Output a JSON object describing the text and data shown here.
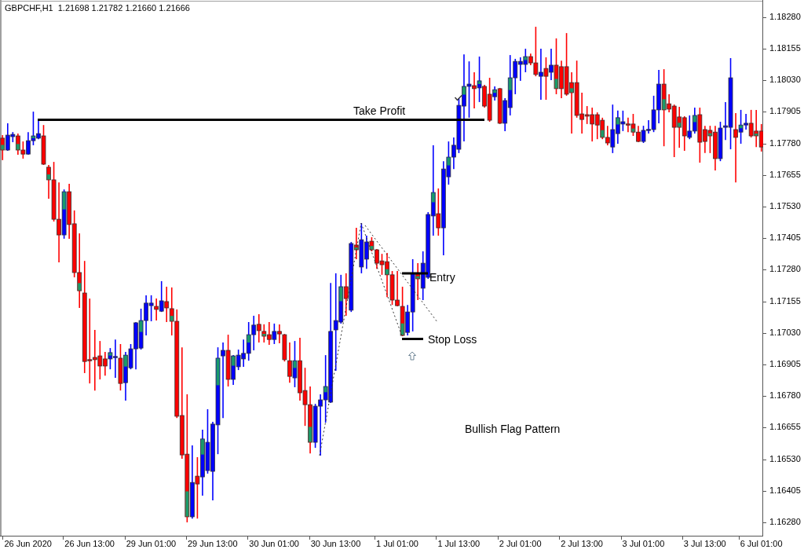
{
  "header": {
    "symbol": "GBPCHF,H1",
    "quote": "1.21698 1.21782 1.21660 1.21666"
  },
  "annotations": [
    {
      "kind": "level",
      "label": "Take Profit"
    },
    {
      "kind": "level",
      "label": "Entry"
    },
    {
      "kind": "level",
      "label": "Stop Loss"
    },
    {
      "kind": "caption",
      "label": "Bullish Flag Pattern"
    }
  ],
  "chart_data": {
    "type": "candlestick",
    "ylim": [
      1.16224,
      1.18348
    ],
    "yticks": [
      {
        "value": 1.1828,
        "label": "1.18280"
      },
      {
        "value": 1.18155,
        "label": "1.18155"
      },
      {
        "value": 1.1803,
        "label": "1.18030"
      },
      {
        "value": 1.17905,
        "label": "1.17905"
      },
      {
        "value": 1.1778,
        "label": "1.17780"
      },
      {
        "value": 1.17655,
        "label": "1.17655"
      },
      {
        "value": 1.1753,
        "label": "1.17530"
      },
      {
        "value": 1.17405,
        "label": "1.17405"
      },
      {
        "value": 1.1728,
        "label": "1.17280"
      },
      {
        "value": 1.17155,
        "label": "1.17155"
      },
      {
        "value": 1.1703,
        "label": "1.17030"
      },
      {
        "value": 1.16905,
        "label": "1.16905"
      },
      {
        "value": 1.1678,
        "label": "1.16780"
      },
      {
        "value": 1.16655,
        "label": "1.16655"
      },
      {
        "value": 1.1653,
        "label": "1.16530"
      },
      {
        "value": 1.16405,
        "label": "1.16405"
      },
      {
        "value": 1.1628,
        "label": "1.16280"
      }
    ],
    "categories": [
      null,
      null,
      null,
      null,
      null,
      "26 Jun 2020",
      null,
      null,
      null,
      null,
      null,
      null,
      null,
      null,
      null,
      null,
      null,
      "26 Jun 13:00",
      null,
      null,
      null,
      null,
      null,
      null,
      null,
      null,
      null,
      null,
      null,
      "29 Jun 01:00",
      null,
      null,
      null,
      null,
      null,
      null,
      null,
      null,
      null,
      null,
      null,
      "29 Jun 13:00",
      null,
      null,
      null,
      null,
      null,
      null,
      null,
      null,
      null,
      null,
      null,
      "30 Jun 01:00",
      null,
      null,
      null,
      null,
      null,
      null,
      null,
      null,
      null,
      null,
      null,
      "30 Jun 13:00",
      null,
      null,
      null,
      null,
      null,
      null,
      null,
      null,
      null,
      null,
      null,
      "1 Jul 01:00",
      null,
      null,
      null,
      null,
      null,
      null,
      null,
      null,
      null,
      null,
      null,
      "1 Jul 13:00",
      null,
      null,
      null,
      null,
      null,
      null,
      null,
      null,
      null,
      null,
      null,
      "2 Jul 01:00",
      null,
      null,
      null,
      null,
      null,
      null,
      null,
      null,
      null,
      null,
      null,
      "2 Jul 13:00",
      null,
      null,
      null,
      null,
      null,
      null,
      null,
      null,
      null,
      null,
      null,
      "3 Jul 01:00",
      null,
      null,
      null,
      null,
      null,
      null,
      null,
      null,
      null,
      null,
      null,
      "3 Jul 13:00",
      null,
      null,
      null,
      null,
      null,
      null,
      null,
      null,
      null,
      null,
      "6 Jul 01:00"
    ],
    "ohlc": [
      [
        1.17801,
        1.17813,
        1.17714,
        1.17754
      ],
      [
        1.17754,
        1.1786,
        1.17751,
        1.17813
      ],
      [
        1.17807,
        1.17825,
        1.17785,
        1.17816
      ],
      [
        1.1781,
        1.17819,
        1.17735,
        1.17754
      ],
      [
        1.17754,
        1.17788,
        1.1772,
        1.17738
      ],
      [
        1.17738,
        1.17825,
        1.17735,
        1.17791
      ],
      [
        1.17791,
        1.17906,
        1.17773,
        1.1781
      ],
      [
        1.17801,
        1.17872,
        1.17797,
        1.17819
      ],
      [
        1.1781,
        1.17853,
        1.17695,
        1.17698
      ],
      [
        1.17686,
        1.17695,
        1.17561,
        1.17636
      ],
      [
        1.17636,
        1.17707,
        1.17471,
        1.1748
      ],
      [
        1.1748,
        1.17626,
        1.17309,
        1.17418
      ],
      [
        1.17418,
        1.17598,
        1.17403,
        1.17589
      ],
      [
        1.17589,
        1.1762,
        1.17403,
        1.17459
      ],
      [
        1.17462,
        1.17515,
        1.1725,
        1.17269
      ],
      [
        1.17269,
        1.17424,
        1.17129,
        1.17197
      ],
      [
        1.17188,
        1.17315,
        1.16871,
        1.16917
      ],
      [
        1.16924,
        1.17166,
        1.1683,
        1.1692
      ],
      [
        1.16933,
        1.17042,
        1.16802,
        1.16924
      ],
      [
        1.16939,
        1.16998,
        1.16846,
        1.16899
      ],
      [
        1.16927,
        1.16955,
        1.16861,
        1.16899
      ],
      [
        1.16927,
        1.1697,
        1.16886,
        1.16952
      ],
      [
        1.16933,
        1.17004,
        1.16852,
        1.16936
      ],
      [
        1.1693,
        1.16986,
        1.16802,
        1.1683
      ],
      [
        1.16833,
        1.16955,
        1.16762,
        1.16942
      ],
      [
        1.16892,
        1.16986,
        1.16886,
        1.16967
      ],
      [
        1.16967,
        1.17073,
        1.16886,
        1.1707
      ],
      [
        1.1697,
        1.17126,
        1.16964,
        1.17079
      ],
      [
        1.17079,
        1.17179,
        1.1702,
        1.17148
      ],
      [
        1.17138,
        1.17179,
        1.17076,
        1.17148
      ],
      [
        1.17135,
        1.17166,
        1.17079,
        1.17123
      ],
      [
        1.17116,
        1.17235,
        1.17113,
        1.17157
      ],
      [
        1.17154,
        1.17213,
        1.17073,
        1.17129
      ],
      [
        1.17126,
        1.1721,
        1.1702,
        1.17076
      ],
      [
        1.17076,
        1.17123,
        1.16693,
        1.167
      ],
      [
        1.16703,
        1.16973,
        1.16532,
        1.16547
      ],
      [
        1.1655,
        1.16787,
        1.1628,
        1.16302
      ],
      [
        1.16302,
        1.16585,
        1.16295,
        1.16438
      ],
      [
        1.16463,
        1.16538,
        1.16295,
        1.16432
      ],
      [
        1.1646,
        1.16647,
        1.16386,
        1.1661
      ],
      [
        1.16485,
        1.16728,
        1.16473,
        1.16597
      ],
      [
        1.16482,
        1.16678,
        1.16367,
        1.16669
      ],
      [
        1.16666,
        1.16973,
        1.1655,
        1.1693
      ],
      [
        1.16939,
        1.16992,
        1.16693,
        1.16961
      ],
      [
        1.16961,
        1.17023,
        1.16818,
        1.16846
      ],
      [
        1.16846,
        1.16942,
        1.16824,
        1.16939
      ],
      [
        1.16896,
        1.16964,
        1.16883,
        1.16942
      ],
      [
        1.16927,
        1.17004,
        1.16896,
        1.16949
      ],
      [
        1.16949,
        1.17073,
        1.1692,
        1.17023
      ],
      [
        1.17023,
        1.17098,
        1.16961,
        1.17061
      ],
      [
        1.17064,
        1.17104,
        1.16992,
        1.17039
      ],
      [
        1.17036,
        1.17064,
        1.16992,
        1.17017
      ],
      [
        1.17023,
        1.17073,
        1.16983,
        1.17004
      ],
      [
        1.17004,
        1.17067,
        1.16986,
        1.17036
      ],
      [
        1.17036,
        1.17064,
        1.16989,
        1.17026
      ],
      [
        1.17023,
        1.17026,
        1.16917,
        1.16924
      ],
      [
        1.1692,
        1.16992,
        1.16833,
        1.16858
      ],
      [
        1.16852,
        1.16998,
        1.16815,
        1.1692
      ],
      [
        1.1692,
        1.17011,
        1.16762,
        1.16793
      ],
      [
        1.16802,
        1.16892,
        1.16662,
        1.16746
      ],
      [
        1.16746,
        1.16818,
        1.16553,
        1.16597
      ],
      [
        1.16597,
        1.16749,
        1.16575,
        1.1674
      ],
      [
        1.1674,
        1.16787,
        1.16544,
        1.16765
      ],
      [
        1.16765,
        1.16942,
        1.16675,
        1.16818
      ],
      [
        1.16756,
        1.17228,
        1.16753,
        1.17036
      ],
      [
        1.17042,
        1.17266,
        1.1688,
        1.17079
      ],
      [
        1.17073,
        1.1726,
        1.17067,
        1.17213
      ],
      [
        1.17213,
        1.17266,
        1.17098,
        1.17166
      ],
      [
        1.1712,
        1.1739,
        1.17113,
        1.17384
      ],
      [
        1.17378,
        1.17446,
        1.17322,
        1.17359
      ],
      [
        1.17291,
        1.17465,
        1.17266,
        1.17399
      ],
      [
        1.17322,
        1.17415,
        1.17284,
        1.1739
      ],
      [
        1.17393,
        1.17409,
        1.17353,
        1.17359
      ],
      [
        1.17359,
        1.17362,
        1.17284,
        1.17306
      ],
      [
        1.17315,
        1.17343,
        1.1726,
        1.173
      ],
      [
        1.17312,
        1.17347,
        1.17172,
        1.1726
      ],
      [
        1.1726,
        1.17275,
        1.17141,
        1.1716
      ],
      [
        1.1716,
        1.17275,
        1.17135,
        1.17138
      ],
      [
        1.17135,
        1.17213,
        1.17017,
        1.1702
      ],
      [
        1.17032,
        1.17141,
        1.1702,
        1.17113
      ],
      [
        1.17113,
        1.17322,
        1.17036,
        1.17266
      ],
      [
        1.17266,
        1.17306,
        1.1716,
        1.17244
      ],
      [
        1.17207,
        1.17353,
        1.1716,
        1.17306
      ],
      [
        1.1725,
        1.17508,
        1.17244,
        1.17499
      ],
      [
        1.17493,
        1.17773,
        1.17415,
        1.17586
      ],
      [
        1.17502,
        1.17602,
        1.17415,
        1.17446
      ],
      [
        1.17446,
        1.1771,
        1.17337,
        1.17679
      ],
      [
        1.17648,
        1.17788,
        1.17617,
        1.17726
      ],
      [
        1.17726,
        1.17804,
        1.17679,
        1.17773
      ],
      [
        1.17757,
        1.17959,
        1.17742,
        1.17931
      ],
      [
        1.17928,
        1.18133,
        1.17788,
        1.18006
      ],
      [
        1.18006,
        1.18105,
        1.17882,
        1.18015
      ],
      [
        1.18009,
        1.18062,
        1.17919,
        1.17997
      ],
      [
        1.18,
        1.18124,
        1.17944,
        1.18028
      ],
      [
        1.18006,
        1.18012,
        1.17922,
        1.17928
      ],
      [
        1.17975,
        1.1804,
        1.17866,
        1.17872
      ],
      [
        1.17965,
        1.18006,
        1.1795,
        1.17993
      ],
      [
        1.17997,
        1.18,
        1.17857,
        1.1786
      ],
      [
        1.1786,
        1.17959,
        1.17829,
        1.1795
      ],
      [
        1.17922,
        1.1813,
        1.17891,
        1.1804
      ],
      [
        1.1804,
        1.18115,
        1.17975,
        1.18105
      ],
      [
        1.18093,
        1.18121,
        1.18028,
        1.18105
      ],
      [
        1.18093,
        1.18155,
        1.18062,
        1.18124
      ],
      [
        1.18124,
        1.18136,
        1.1809,
        1.18099
      ],
      [
        1.18099,
        1.18242,
        1.18046,
        1.18053
      ],
      [
        1.18046,
        1.18155,
        1.17953,
        1.18062
      ],
      [
        1.18077,
        1.18121,
        1.17953,
        1.18046
      ],
      [
        1.18062,
        1.18155,
        1.18031,
        1.1809
      ],
      [
        1.1809,
        1.18196,
        1.17975,
        1.17997
      ],
      [
        1.18084,
        1.18108,
        1.17959,
        1.17997
      ],
      [
        1.18084,
        1.18217,
        1.17969,
        1.17975
      ],
      [
        1.18021,
        1.18062,
        1.17819,
        1.17981
      ],
      [
        1.18021,
        1.18108,
        1.17882,
        1.17891
      ],
      [
        1.17897,
        1.17981,
        1.17819,
        1.17875
      ],
      [
        1.17894,
        1.17928,
        1.17857,
        1.17888
      ],
      [
        1.17894,
        1.17922,
        1.17788,
        1.17857
      ],
      [
        1.17894,
        1.17903,
        1.17797,
        1.17853
      ],
      [
        1.17872,
        1.17882,
        1.17797,
        1.17804
      ],
      [
        1.17804,
        1.1785,
        1.17773,
        1.17782
      ],
      [
        1.17766,
        1.17934,
        1.17742,
        1.17835
      ],
      [
        1.17819,
        1.1791,
        1.17779,
        1.17882
      ],
      [
        1.17857,
        1.1791,
        1.17829,
        1.17866
      ],
      [
        1.17857,
        1.17882,
        1.17825,
        1.17853
      ],
      [
        1.17857,
        1.17897,
        1.1781,
        1.17825
      ],
      [
        1.17825,
        1.1785,
        1.17785,
        1.17788
      ],
      [
        1.17788,
        1.1785,
        1.17782,
        1.17832
      ],
      [
        1.17832,
        1.17872,
        1.17819,
        1.17835
      ],
      [
        1.17835,
        1.17969,
        1.17825,
        1.17913
      ],
      [
        1.17913,
        1.18071,
        1.1786,
        1.18015
      ],
      [
        1.18015,
        1.18074,
        1.17769,
        1.17913
      ],
      [
        1.17937,
        1.17975,
        1.17903,
        1.17916
      ],
      [
        1.17928,
        1.17934,
        1.17726,
        1.17844
      ],
      [
        1.17885,
        1.17925,
        1.17763,
        1.17844
      ],
      [
        1.17882,
        1.17888,
        1.17751,
        1.1781
      ],
      [
        1.17804,
        1.17891,
        1.17797,
        1.17829
      ],
      [
        1.17829,
        1.17922,
        1.17819,
        1.17891
      ],
      [
        1.17894,
        1.17922,
        1.17704,
        1.17785
      ],
      [
        1.17835,
        1.1785,
        1.17742,
        1.17788
      ],
      [
        1.17832,
        1.1785,
        1.17742,
        1.1781
      ],
      [
        1.17825,
        1.1785,
        1.17673,
        1.1772
      ],
      [
        1.1772,
        1.17866,
        1.1771,
        1.17841
      ],
      [
        1.17844,
        1.17944,
        1.17794,
        1.1785
      ],
      [
        1.17844,
        1.18118,
        1.17757,
        1.1804
      ],
      [
        1.17835,
        1.179,
        1.17626,
        1.17804
      ],
      [
        1.17825,
        1.17913,
        1.17779,
        1.17853
      ],
      [
        1.17853,
        1.17897,
        1.17835,
        1.1786
      ],
      [
        1.1786,
        1.17913,
        1.17804,
        1.1781
      ],
      [
        1.17829,
        1.17913,
        1.17766,
        1.1781
      ],
      [
        1.17829,
        1.17857,
        1.17748,
        1.17766
      ]
    ]
  }
}
